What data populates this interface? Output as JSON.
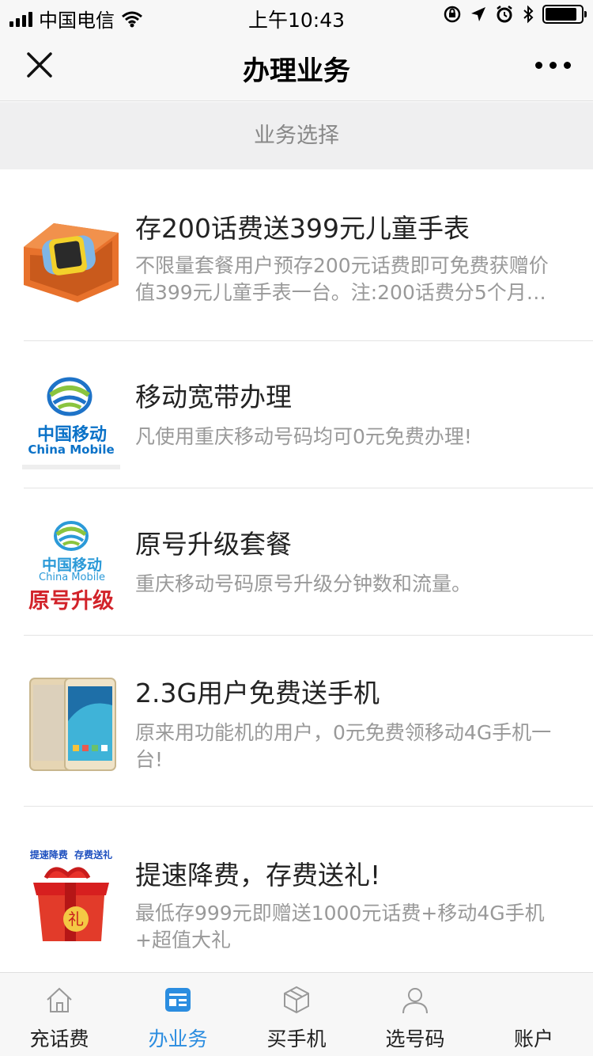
{
  "status_bar": {
    "carrier": "中国电信",
    "time": "上午10:43"
  },
  "nav": {
    "title": "办理业务"
  },
  "section": {
    "title": "业务选择"
  },
  "items": [
    {
      "title": "存200话费送399元儿童手表",
      "desc": "不限量套餐用户预存200元话费即可免费获赠价值399元儿童手表一台。注:200话费分5个月…",
      "thumb": "kids-watch-image"
    },
    {
      "title": "移动宽带办理",
      "desc": "凡使用重庆移动号码均可0元免费办理!",
      "thumb": "china-mobile-logo",
      "logo_cn": "中国移动",
      "logo_en": "China Mobile"
    },
    {
      "title": "原号升级套餐",
      "desc": "重庆移动号码原号升级分钟数和流量。",
      "thumb": "upgrade-logo",
      "logo_cn": "中国移动",
      "logo_en": "China Mobile",
      "logo_tag": "原号升级"
    },
    {
      "title": "2.3G用户免费送手机",
      "desc": "原来用功能机的用户，0元免费领移动4G手机一台!",
      "thumb": "smartphone-image"
    },
    {
      "title": "提速降费，存费送礼!",
      "desc": "最低存999元即赠送1000元话费+移动4G手机+超值大礼",
      "thumb": "gift-box-image",
      "gift_caption": "提速降费  存费送礼"
    }
  ],
  "tabs": [
    {
      "label": "充话费",
      "icon": "home-icon",
      "active": false
    },
    {
      "label": "办业务",
      "icon": "service-card-icon",
      "active": true
    },
    {
      "label": "买手机",
      "icon": "box-icon",
      "active": false
    },
    {
      "label": "选号码",
      "icon": "user-icon",
      "active": false
    },
    {
      "label": "账户",
      "icon": "account-icon",
      "active": false
    }
  ],
  "colors": {
    "accent": "#2b8de0",
    "brand_blue": "#0b72c8",
    "promo_red": "#d2232a"
  }
}
